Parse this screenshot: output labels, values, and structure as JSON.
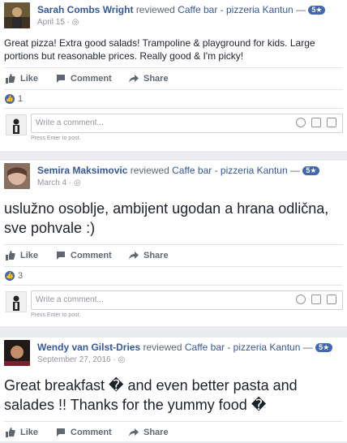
{
  "reviews": [
    {
      "name": "Sarah Combs Wright",
      "verb": "reviewed",
      "page": "Caffe bar - pizzeria Kantun",
      "dash": "—",
      "stars": "5★",
      "date": "April 15 ·",
      "text": "Great pizza! Extra good salads! Trampoline & playground for kids. Large portions but reasonable prices. Really good & I'm picky!",
      "like_label": "Like",
      "comment_label": "Comment",
      "share_label": "Share",
      "reaction_count": "1",
      "comment_placeholder": "Write a comment...",
      "hint": "Press Enter to post."
    },
    {
      "name": "Semira Maksimovic",
      "verb": "reviewed",
      "page": "Caffe bar - pizzeria Kantun",
      "dash": "—",
      "stars": "5★",
      "date": "March 4 ·",
      "text": "uslužno osoblje, ambijent ugodan a hrana odlična, sve pohvale :)",
      "like_label": "Like",
      "comment_label": "Comment",
      "share_label": "Share",
      "reaction_count": "3",
      "comment_placeholder": "Write a comment...",
      "hint": "Press Enter to post."
    },
    {
      "name": "Wendy van Gilst-Dries",
      "verb": "reviewed",
      "page": "Caffe bar - pizzeria Kantun",
      "dash": "—",
      "stars": "5★",
      "date": "September 27, 2016 ·",
      "text": "Great breakfast � and even better pasta and salades !! Thanks for the yummy food �",
      "like_label": "Like",
      "comment_label": "Comment",
      "share_label": "Share"
    }
  ],
  "colors": {
    "link": "#365899",
    "accent": "#4267b2",
    "muted": "#90949c"
  }
}
